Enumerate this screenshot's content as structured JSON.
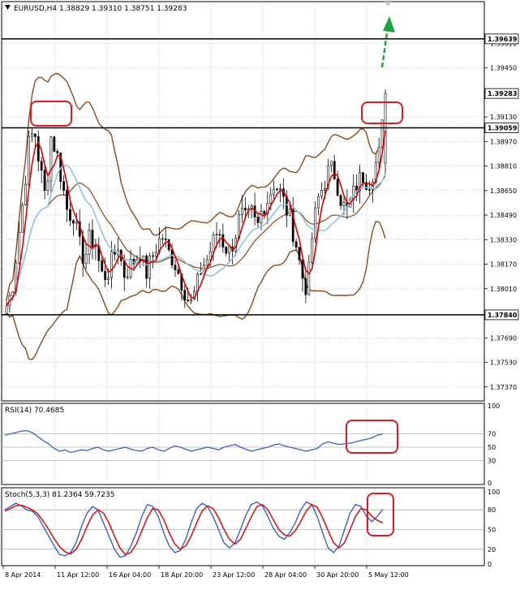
{
  "header": {
    "text": "EURUSD,H4  1.38829 1.39310 1.38751 1.39283"
  },
  "colors": {
    "bull": "#000000",
    "bear": "#000000",
    "bb": "#8B4A1E",
    "ma_red": "#E00000",
    "ma_blue": "#8EC6E0",
    "rsi": "#3B62C9",
    "stoch_main": "#3B62C9",
    "stoch_signal": "#D81B1B",
    "levels": "#000000",
    "annot": "#E01B24",
    "arrow": "#1FA33C"
  },
  "icons": {
    "top_marker": "triangle-down-icon"
  },
  "price_axis": {
    "ticks": [
      "1.39610",
      "1.39450",
      "1.39130",
      "1.38970",
      "1.38810",
      "1.38650",
      "1.38490",
      "1.38330",
      "1.38170",
      "1.38010",
      "1.37690",
      "1.37530",
      "1.37370"
    ],
    "tags": [
      "1.39639",
      "1.39283",
      "1.39059",
      "1.37840"
    ]
  },
  "rsi_panel": {
    "title": "RSI(14) 70.4685",
    "ticks": [
      "100",
      "70",
      "50",
      "30",
      "0"
    ]
  },
  "stoch_panel": {
    "title": "Stoch(5,3,3) 81.2364 59.7235",
    "ticks": [
      "100",
      "80",
      "50",
      "20",
      "0"
    ]
  },
  "time_axis": {
    "labels": [
      "8 Apr 2014",
      "11 Apr 12:00",
      "16 Apr 04:00",
      "18 Apr 20:00",
      "23 Apr 12:00",
      "28 Apr 04:00",
      "30 Apr 20:00",
      "5 May 12:00"
    ]
  },
  "chart_data": [
    {
      "type": "candlestick",
      "title": "EURUSD,H4",
      "ohlc_last": {
        "open": 1.38829,
        "high": 1.3931,
        "low": 1.38751,
        "close": 1.39283
      },
      "ylim": [
        1.373,
        1.3985
      ],
      "levels": [
        1.39639,
        1.39059,
        1.3784
      ],
      "close_path": [
        1.379,
        1.38,
        1.383,
        1.386,
        1.3895,
        1.3905,
        1.388,
        1.386,
        1.39,
        1.389,
        1.387,
        1.385,
        1.385,
        1.383,
        1.382,
        1.3835,
        1.383,
        1.381,
        1.381,
        1.382,
        1.383,
        1.381,
        1.3815,
        1.382,
        1.3825,
        1.381,
        1.382,
        1.383,
        1.3835,
        1.3825,
        1.382,
        1.381,
        1.38,
        1.379,
        1.38,
        1.3815,
        1.382,
        1.383,
        1.384,
        1.383,
        1.3825,
        1.3835,
        1.385,
        1.3845,
        1.385,
        1.384,
        1.3855,
        1.386,
        1.387,
        1.3865,
        1.3855,
        1.3845,
        1.383,
        1.381,
        1.38,
        1.384,
        1.386,
        1.387,
        1.388,
        1.3875,
        1.386,
        1.385,
        1.386,
        1.387,
        1.3875,
        1.387,
        1.388,
        1.389,
        1.3928
      ]
    },
    {
      "type": "line",
      "title": "RSI(14) 70.4685",
      "ylim": [
        0,
        100
      ],
      "levels": [
        70,
        50,
        30
      ],
      "values": [
        68,
        70,
        72,
        74,
        75,
        72,
        66,
        60,
        55,
        48,
        44,
        46,
        42,
        44,
        46,
        45,
        48,
        50,
        46,
        44,
        46,
        48,
        50,
        47,
        45,
        44,
        48,
        50,
        46,
        44,
        48,
        52,
        50,
        47,
        44,
        46,
        48,
        50,
        48,
        46,
        50,
        52,
        54,
        50,
        47,
        44,
        46,
        48,
        50,
        53,
        55,
        52,
        50,
        48,
        46,
        44,
        46,
        48,
        55,
        58,
        56,
        54,
        55,
        56,
        58,
        60,
        62,
        64,
        68,
        70
      ]
    },
    {
      "type": "line",
      "title": "Stoch(5,3,3) 81.2364 59.7235",
      "ylim": [
        0,
        100
      ],
      "levels": [
        80,
        50,
        20
      ],
      "series": [
        {
          "values": [
            80,
            85,
            90,
            86,
            80,
            78,
            70,
            55,
            40,
            25,
            12,
            10,
            15,
            30,
            55,
            75,
            85,
            80,
            60,
            40,
            20,
            8,
            10,
            25,
            45,
            70,
            88,
            85,
            70,
            45,
            25,
            15,
            18,
            35,
            60,
            82,
            90,
            85,
            70,
            50,
            30,
            22,
            30,
            50,
            72,
            88,
            92,
            86,
            70,
            52,
            40,
            35,
            45,
            60,
            80,
            92,
            88,
            70,
            45,
            22,
            15,
            25,
            50,
            75,
            88,
            85,
            70,
            62,
            70,
            81
          ]
        },
        {
          "values": [
            78,
            82,
            86,
            87,
            84,
            80,
            74,
            63,
            50,
            36,
            24,
            16,
            13,
            20,
            35,
            55,
            72,
            80,
            75,
            60,
            40,
            22,
            12,
            15,
            28,
            48,
            68,
            82,
            80,
            65,
            45,
            28,
            20,
            25,
            40,
            60,
            78,
            86,
            82,
            68,
            50,
            35,
            28,
            35,
            52,
            70,
            85,
            88,
            80,
            65,
            50,
            42,
            40,
            48,
            62,
            78,
            88,
            84,
            68,
            48,
            30,
            22,
            30,
            50,
            70,
            82,
            80,
            70,
            64,
            60
          ]
        }
      ]
    }
  ]
}
